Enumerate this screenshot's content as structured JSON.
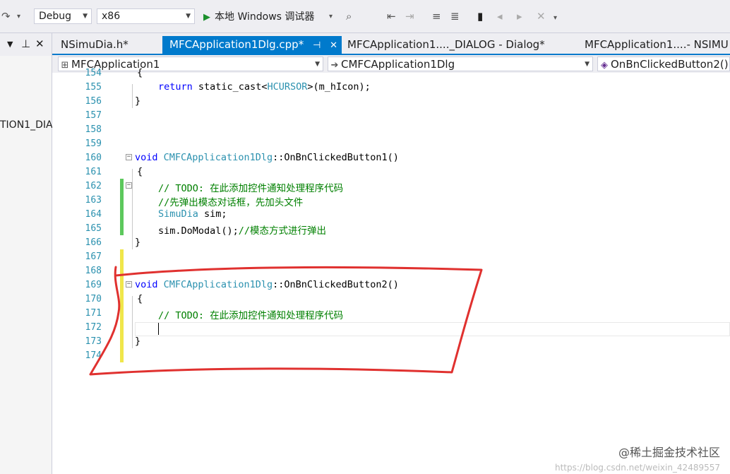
{
  "toolbar": {
    "config": "Debug",
    "platform": "x86",
    "run_label": "本地 Windows 调试器"
  },
  "left_panel": {
    "tree_item": "TION1_DIA"
  },
  "tabs": [
    {
      "label": "NSimuDia.h*",
      "active": false
    },
    {
      "label": "MFCApplication1Dlg.cpp*",
      "active": true
    },
    {
      "label": "MFCApplication1...._DIALOG - Dialog*",
      "active": false
    },
    {
      "label": "MFCApplication1....- NSIMU",
      "active": false
    }
  ],
  "navbar": {
    "project": "MFCApplication1",
    "class": "CMFCApplication1Dlg",
    "member": "OnBnClickedButton2()"
  },
  "code_lines": [
    {
      "n": "154",
      "text": "{"
    },
    {
      "n": "155",
      "text": "return static_cast<HCURSOR>(m_hIcon);"
    },
    {
      "n": "156",
      "text": "}"
    },
    {
      "n": "157",
      "text": ""
    },
    {
      "n": "158",
      "text": ""
    },
    {
      "n": "159",
      "text": ""
    },
    {
      "n": "160",
      "text": "void CMFCApplication1Dlg::OnBnClickedButton1()"
    },
    {
      "n": "161",
      "text": "{"
    },
    {
      "n": "162",
      "text": "// TODO: 在此添加控件通知处理程序代码"
    },
    {
      "n": "163",
      "text": "//先弹出模态对话框，先加头文件"
    },
    {
      "n": "164",
      "text": "SimuDia sim;"
    },
    {
      "n": "165",
      "text": "sim.DoModal();//模态方式进行弹出"
    },
    {
      "n": "166",
      "text": "}"
    },
    {
      "n": "167",
      "text": ""
    },
    {
      "n": "168",
      "text": ""
    },
    {
      "n": "169",
      "text": "void CMFCApplication1Dlg::OnBnClickedButton2()"
    },
    {
      "n": "170",
      "text": "{"
    },
    {
      "n": "171",
      "text": "// TODO: 在此添加控件通知处理程序代码"
    },
    {
      "n": "172",
      "text": ""
    },
    {
      "n": "173",
      "text": "}"
    },
    {
      "n": "174",
      "text": ""
    }
  ],
  "watermark": "@稀土掘金技术社区",
  "watermark_url": "https://blog.csdn.net/weixin_42489557"
}
